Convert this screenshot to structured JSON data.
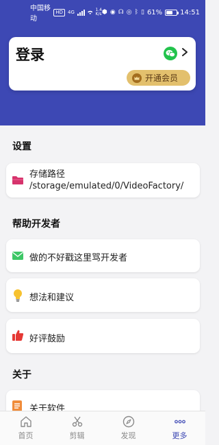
{
  "status_bar": {
    "carrier": "中国移动",
    "hd_badge": "HD",
    "signal": "4G",
    "speed_top": "1.4",
    "speed_bottom": "K/s",
    "battery_percent": "61%",
    "battery_level": 0.61,
    "time": "14:51"
  },
  "colors": {
    "header": "#3d48b4",
    "accent": "#3d48b4",
    "vip": "#e3c06d",
    "wechat": "#22c34c"
  },
  "login": {
    "title": "登录",
    "vip_label": "开通会员"
  },
  "sections": {
    "settings": "设置",
    "help": "帮助开发者",
    "about": "关于"
  },
  "storage": {
    "label": "存储路径",
    "path": "/storage/emulated/0/VideoFactory/"
  },
  "help_items": [
    {
      "label": "做的不好戳这里骂开发者",
      "icon": "mail-icon"
    },
    {
      "label": "想法和建议",
      "icon": "lightbulb-icon"
    },
    {
      "label": "好评鼓励",
      "icon": "thumbs-up-icon"
    }
  ],
  "about_items": [
    {
      "label": "关于软件",
      "icon": "document-icon"
    }
  ],
  "bottom_nav": [
    {
      "label": "首页",
      "icon": "home-icon"
    },
    {
      "label": "剪辑",
      "icon": "scissors-icon"
    },
    {
      "label": "发现",
      "icon": "compass-icon"
    },
    {
      "label": "更多",
      "icon": "more-icon",
      "active": true
    }
  ]
}
